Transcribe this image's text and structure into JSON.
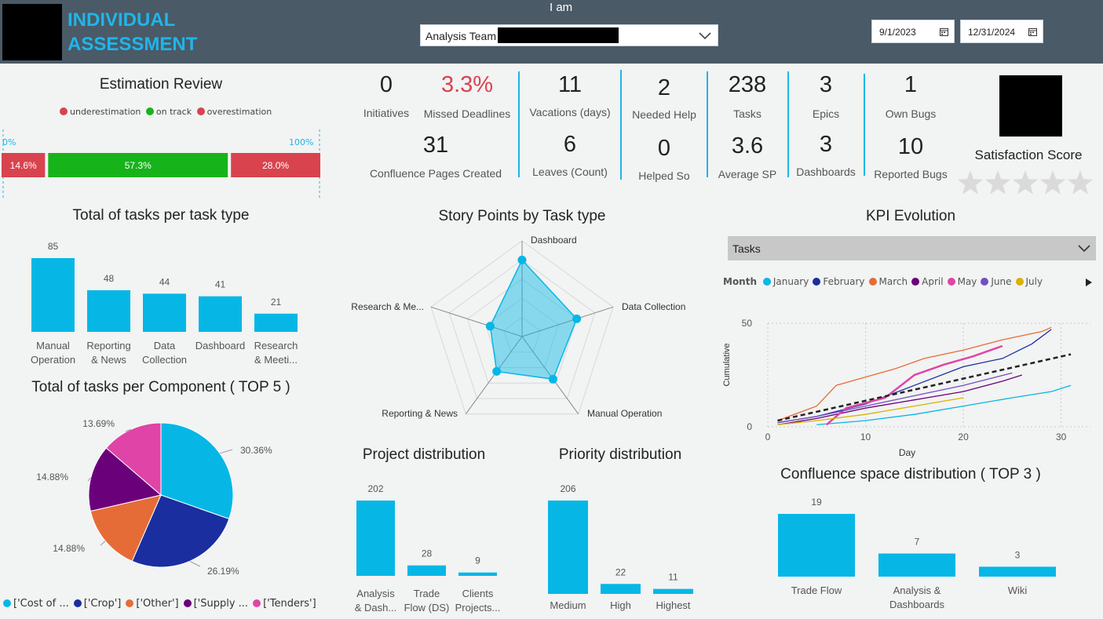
{
  "header": {
    "title_line1": "INDIVIDUAL",
    "title_line2": "ASSESSMENT",
    "iam_label": "I am",
    "team_value": "Analysis Team",
    "date_start": "9/1/2023",
    "date_end": "12/31/2024"
  },
  "estimation": {
    "title": "Estimation Review",
    "legend": [
      {
        "label": "underestimation",
        "color": "#d9434e"
      },
      {
        "label": "on track",
        "color": "#17b31a"
      },
      {
        "label": "overestimation",
        "color": "#d9434e"
      }
    ],
    "min_label": "0%",
    "max_label": "100%",
    "segments": [
      {
        "label": "14.6%",
        "value": 14.6,
        "color": "#d9434e"
      },
      {
        "label": "57.3%",
        "value": 57.3,
        "color": "#17b31a"
      },
      {
        "label": "28.0%",
        "value": 28.0,
        "color": "#d9434e"
      }
    ]
  },
  "kpis": {
    "initiatives": {
      "value": "0",
      "label": "Initiatives"
    },
    "missed": {
      "value": "3.3%",
      "label": "Missed Deadlines",
      "color": "#d9434e"
    },
    "confluence": {
      "value": "31",
      "label": "Confluence Pages Created"
    },
    "vacations": {
      "value": "11",
      "label": "Vacations (days)"
    },
    "leaves": {
      "value": "6",
      "label": "Leaves (Count)"
    },
    "needed_help": {
      "value": "2",
      "label": "Needed Help"
    },
    "helped_so": {
      "value": "0",
      "label": "Helped So"
    },
    "tasks": {
      "value": "238",
      "label": "Tasks"
    },
    "avg_sp": {
      "value": "3.6",
      "label": "Average SP"
    },
    "epics": {
      "value": "3",
      "label": "Epics"
    },
    "dashboards": {
      "value": "3",
      "label": "Dashboards"
    },
    "own_bugs": {
      "value": "1",
      "label": "Own Bugs"
    },
    "reported_bugs": {
      "value": "10",
      "label": "Reported Bugs"
    },
    "satisfaction": {
      "label": "Satisfaction Score",
      "stars_filled": 0,
      "stars_total": 5
    }
  },
  "tasks_per_type": {
    "title": "Total of tasks per task type",
    "chart_data": {
      "type": "bar",
      "categories": [
        "Manual Operation",
        "Reporting & News",
        "Data Collection",
        "Dashboard",
        "Research & Meeti..."
      ],
      "category_lines": [
        [
          "Manual",
          "Operation"
        ],
        [
          "Reporting",
          "& News"
        ],
        [
          "Data",
          "Collection"
        ],
        [
          "Dashboard"
        ],
        [
          "Research",
          "& Meeti..."
        ]
      ],
      "values": [
        85,
        48,
        44,
        41,
        21
      ],
      "color": "#06b7e6"
    }
  },
  "tasks_per_component": {
    "title": "Total of tasks per Component ( TOP 5 )",
    "chart_data": {
      "type": "pie",
      "slices": [
        {
          "label": "['Cost of ...",
          "value": 30.36,
          "text": "30.36%",
          "color": "#06b7e6"
        },
        {
          "label": "['Crop']",
          "value": 26.19,
          "text": "26.19%",
          "color": "#1a2ea0"
        },
        {
          "label": "['Other']",
          "value": 14.88,
          "text": "14.88%",
          "color": "#e66c37"
        },
        {
          "label": "['Supply ...",
          "value": 14.88,
          "text": "14.88%",
          "color": "#6b007b"
        },
        {
          "label": "['Tenders']",
          "value": 13.69,
          "text": "13.69%",
          "color": "#e044a7"
        }
      ]
    }
  },
  "story_points": {
    "title": "Story Points by Task type",
    "chart_data": {
      "type": "radar",
      "axes": [
        "Dashboard",
        "Data Collection",
        "Manual Operation",
        "Reporting & News",
        "Research & Me..."
      ],
      "values": [
        0.8,
        0.6,
        0.55,
        0.45,
        0.35
      ],
      "color": "#06b7e6"
    }
  },
  "kpi_evolution": {
    "title": "KPI Evolution",
    "dropdown_value": "Tasks",
    "legend_title": "Month",
    "chart_data": {
      "type": "line",
      "xlabel": "Day",
      "ylabel": "Cumulative",
      "xticks": [
        0,
        10,
        20,
        30
      ],
      "yticks": [
        0,
        50
      ],
      "xlim": [
        0,
        33
      ],
      "ylim": [
        0,
        50
      ],
      "series": [
        {
          "name": "January",
          "color": "#06b7e6",
          "x": [
            5,
            10,
            15,
            20,
            25,
            29,
            31
          ],
          "y": [
            1,
            3,
            6,
            10,
            14,
            17,
            20
          ]
        },
        {
          "name": "February",
          "color": "#1a2ea0",
          "x": [
            1,
            5,
            10,
            15,
            20,
            24,
            27,
            29
          ],
          "y": [
            2,
            5,
            11,
            20,
            29,
            33,
            40,
            47
          ]
        },
        {
          "name": "March",
          "color": "#e66c37",
          "x": [
            1,
            5,
            7,
            10,
            13,
            16,
            20,
            24,
            28,
            29
          ],
          "y": [
            3,
            10,
            20,
            24,
            28,
            33,
            37,
            42,
            46,
            48
          ]
        },
        {
          "name": "April",
          "color": "#6b007b",
          "x": [
            1,
            5,
            10,
            15,
            20,
            24,
            26
          ],
          "y": [
            1,
            4,
            9,
            13,
            17,
            22,
            25
          ]
        },
        {
          "name": "May",
          "color": "#e044a7",
          "x": [
            6,
            8,
            12,
            15,
            18,
            21,
            24
          ],
          "y": [
            1,
            9,
            14,
            25,
            30,
            34,
            39
          ]
        },
        {
          "name": "June",
          "color": "#744ec2",
          "x": [
            1,
            5,
            10,
            15,
            20,
            25
          ],
          "y": [
            2,
            5,
            10,
            15,
            20,
            26
          ]
        },
        {
          "name": "July",
          "color": "#d9b300",
          "x": [
            1,
            5,
            10,
            15,
            20
          ],
          "y": [
            1,
            3,
            6,
            10,
            14
          ]
        }
      ],
      "trend": {
        "x": [
          1,
          31
        ],
        "y": [
          3,
          35
        ]
      }
    }
  },
  "project_distribution": {
    "title": "Project distribution",
    "chart_data": {
      "type": "bar",
      "categories": [
        "Analysis & Dash...",
        "Trade Flow (DS)",
        "Clients Projects..."
      ],
      "category_lines": [
        [
          "Analysis",
          "& Dash..."
        ],
        [
          "Trade",
          "Flow (DS)"
        ],
        [
          "Clients",
          "Projects..."
        ]
      ],
      "values": [
        202,
        28,
        9
      ],
      "color": "#06b7e6"
    }
  },
  "priority_distribution": {
    "title": "Priority distribution",
    "chart_data": {
      "type": "bar",
      "categories": [
        "Medium",
        "High",
        "Highest"
      ],
      "category_lines": [
        [
          "Medium"
        ],
        [
          "High"
        ],
        [
          "Highest"
        ]
      ],
      "values": [
        206,
        22,
        11
      ],
      "color": "#06b7e6"
    }
  },
  "confluence_space": {
    "title": "Confluence space distribution ( TOP 3 )",
    "chart_data": {
      "type": "bar",
      "categories": [
        "Trade Flow",
        "Analysis & Dashboards",
        "Wiki"
      ],
      "category_lines": [
        [
          "Trade Flow"
        ],
        [
          "Analysis &",
          "Dashboards"
        ],
        [
          "Wiki"
        ]
      ],
      "values": [
        19,
        7,
        3
      ],
      "color": "#06b7e6"
    }
  }
}
